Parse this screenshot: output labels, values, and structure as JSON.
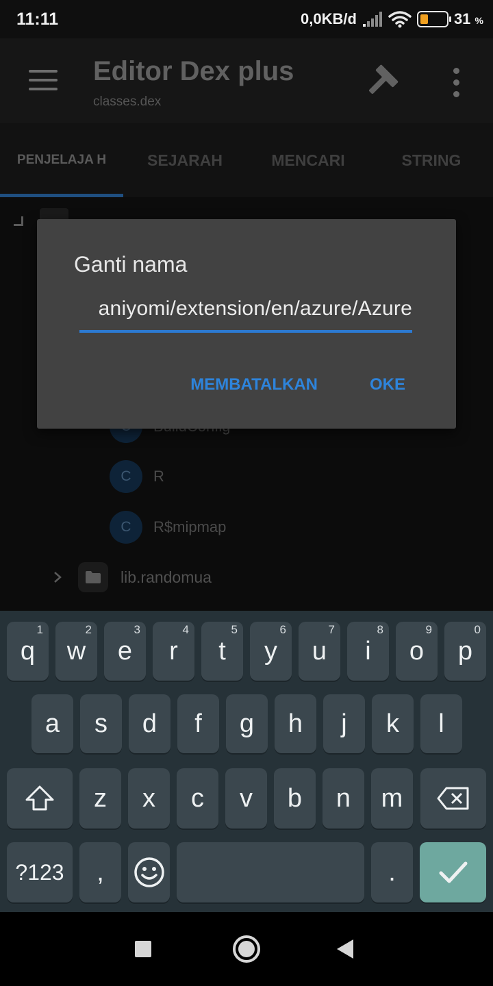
{
  "status_bar": {
    "time": "11:11",
    "net_speed": "0,0KB/d",
    "battery_percent": "31",
    "battery_unit": "%",
    "battery_level": 0.31
  },
  "app_bar": {
    "title": "Editor Dex plus",
    "subtitle": "classes.dex"
  },
  "tabs": [
    {
      "label": "PENJELAJA H",
      "active": true
    },
    {
      "label": "SEJARAH",
      "active": false
    },
    {
      "label": "MENCARI",
      "active": false
    },
    {
      "label": "STRING",
      "active": false
    }
  ],
  "tree": {
    "class_items": [
      {
        "badge": "C",
        "name": "BuildConfig"
      },
      {
        "badge": "C",
        "name": "R"
      },
      {
        "badge": "C",
        "name": "R$mipmap"
      }
    ],
    "folder": {
      "name": "lib.randomua"
    }
  },
  "dialog": {
    "title": "Ganti nama",
    "input_value": "aniyomi/extension/en/azure/Azure",
    "cancel_label": "MEMBATALKAN",
    "ok_label": "OKE"
  },
  "keyboard": {
    "row1": [
      {
        "label": "q",
        "hint": "1"
      },
      {
        "label": "w",
        "hint": "2"
      },
      {
        "label": "e",
        "hint": "3"
      },
      {
        "label": "r",
        "hint": "4"
      },
      {
        "label": "t",
        "hint": "5"
      },
      {
        "label": "y",
        "hint": "6"
      },
      {
        "label": "u",
        "hint": "7"
      },
      {
        "label": "i",
        "hint": "8"
      },
      {
        "label": "o",
        "hint": "9"
      },
      {
        "label": "p",
        "hint": "0"
      }
    ],
    "row2": [
      "a",
      "s",
      "d",
      "f",
      "g",
      "h",
      "j",
      "k",
      "l"
    ],
    "row3": [
      "z",
      "x",
      "c",
      "v",
      "b",
      "n",
      "m"
    ],
    "symbols_label": "?123",
    "comma_label": ",",
    "period_label": "."
  },
  "colors": {
    "accent": "#2e84db",
    "keyboard_bg": "#263238",
    "key_bg": "#3b474e",
    "enter_key": "#6ea89f"
  }
}
